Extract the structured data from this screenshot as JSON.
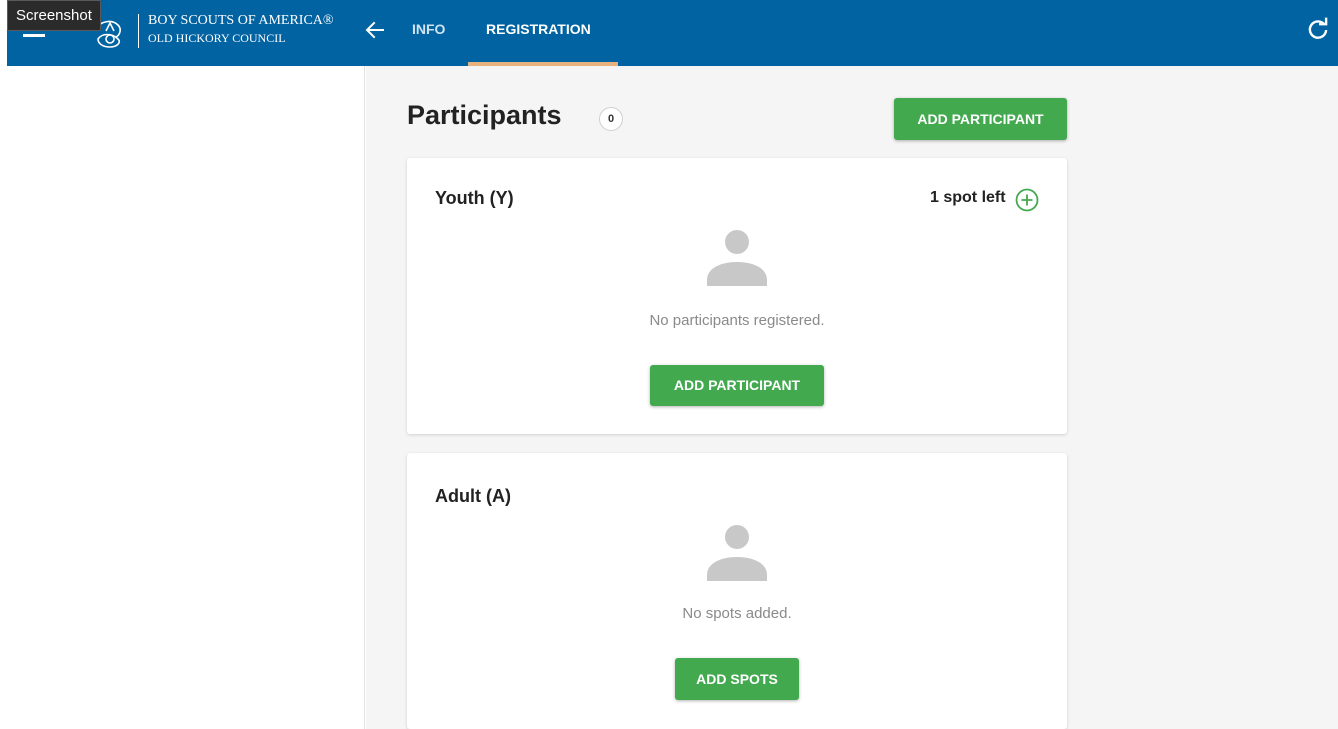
{
  "tooltip": "Screenshot",
  "header": {
    "brand_line1": "BOY SCOUTS OF AMERICA®",
    "brand_line2": "OLD HICKORY COUNCIL",
    "tabs": [
      {
        "label": "INFO"
      },
      {
        "label": "REGISTRATION",
        "active": true
      }
    ],
    "icons": [
      "menu-icon",
      "bsa-logo-icon",
      "back-arrow-icon",
      "refresh-icon"
    ]
  },
  "main": {
    "title": "Participants",
    "count": "0",
    "add_button": "ADD PARTICIPANT"
  },
  "cards": [
    {
      "title": "Youth (Y)",
      "spots_left": "1 spot left",
      "empty_text": "No participants registered.",
      "button": "ADD PARTICIPANT"
    },
    {
      "title": "Adult (A)",
      "empty_text": "No spots added.",
      "button": "ADD SPOTS"
    }
  ],
  "colors": {
    "header_bg": "#0263a2",
    "accent_green": "#43a94f",
    "tab_underline": "#e8b27e",
    "content_bg": "#f5f5f5"
  }
}
